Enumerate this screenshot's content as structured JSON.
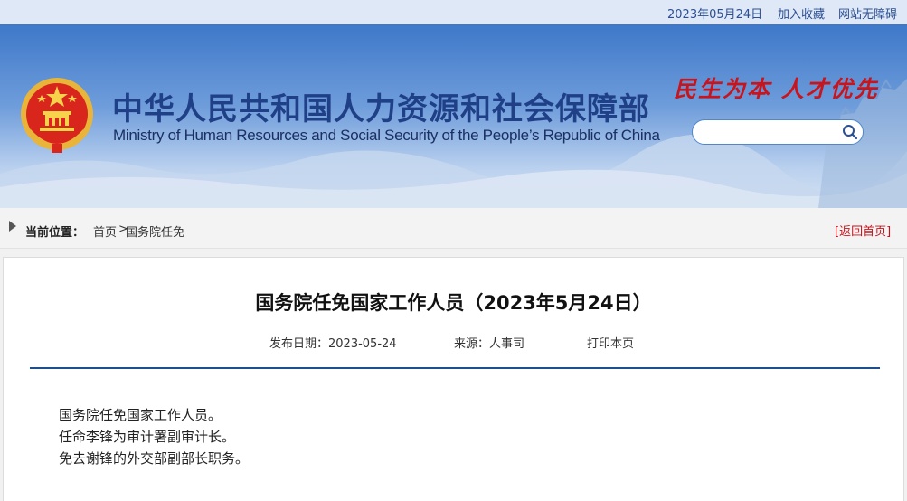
{
  "topbar": {
    "date": "2023年05月24日",
    "favorite": "加入收藏",
    "accessibility": "网站无障碍"
  },
  "header": {
    "title_cn": "中华人民共和国人力资源和社会保障部",
    "title_en": "Ministry of Human Resources and Social Security of the People’s Republic of China",
    "slogan": "民生为本 人才优先",
    "search_placeholder": ""
  },
  "breadcrumb": {
    "label": "当前位置：",
    "home": "首页",
    "separator": ">",
    "current": "国务院任免",
    "back_home": "[返回首页]"
  },
  "article": {
    "title": "国务院任免国家工作人员（2023年5月24日）",
    "publish_date": "发布日期：2023-05-24",
    "source": "来源：人事司",
    "print": "打印本页",
    "paragraphs": [
      "国务院任免国家工作人员。",
      "任命李锋为审计署副审计长。",
      "免去谢锋的外交部副部长职务。"
    ]
  },
  "colors": {
    "banner_blue": "#3e78c9",
    "title_blue": "#1f3f86",
    "slogan_red": "#c8141c",
    "rule_blue": "#1d4f8e"
  }
}
